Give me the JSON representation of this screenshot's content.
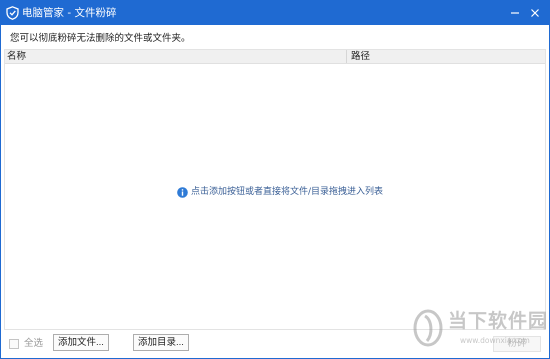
{
  "window": {
    "title": "电脑管家 - 文件粉碎",
    "accent_color": "#1f6ad2",
    "icons": {
      "app": "shield-icon",
      "minimize": "minimize-icon",
      "close": "close-icon"
    }
  },
  "hint_text": "您可以彻底粉碎无法删除的文件或文件夹。",
  "list": {
    "columns": [
      "名称",
      "路径"
    ],
    "rows": [],
    "empty_message": "点击添加按钮或者直接将文件/目录拖拽进入列表",
    "empty_icon": "info-icon"
  },
  "footer": {
    "select_all_label": "全选",
    "select_all_checked": false,
    "add_file_label": "添加文件...",
    "add_dir_label": "添加目录...",
    "shred_label": "粉碎",
    "shred_enabled": false
  },
  "watermark": {
    "text_cn": "当下软件园",
    "text_en": "www.downxia.com"
  }
}
